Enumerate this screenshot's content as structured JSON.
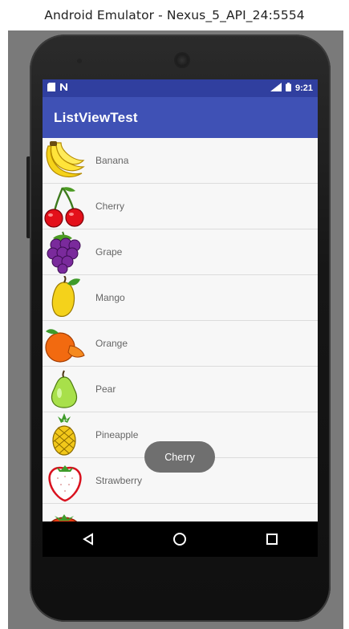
{
  "window": {
    "title": "Android Emulator - Nexus_5_API_24:5554"
  },
  "status_bar": {
    "time": "9:21",
    "left_icons": [
      "sd-card-icon",
      "notification-n-icon"
    ],
    "right_icons": [
      "signal-icon",
      "battery-icon"
    ]
  },
  "app_bar": {
    "title": "ListViewTest"
  },
  "list": {
    "items": [
      {
        "label": "Banana",
        "icon": "banana-icon"
      },
      {
        "label": "Cherry",
        "icon": "cherry-icon"
      },
      {
        "label": "Grape",
        "icon": "grape-icon"
      },
      {
        "label": "Mango",
        "icon": "mango-icon"
      },
      {
        "label": "Orange",
        "icon": "orange-icon"
      },
      {
        "label": "Pear",
        "icon": "pear-icon"
      },
      {
        "label": "Pineapple",
        "icon": "pineapple-icon"
      },
      {
        "label": "Strawberry",
        "icon": "strawberry-icon"
      },
      {
        "label": "",
        "icon": "tomato-icon"
      }
    ]
  },
  "toast": {
    "text": "Cherry"
  },
  "nav_bar": {
    "buttons": [
      "back-icon",
      "home-icon",
      "recents-icon"
    ]
  },
  "colors": {
    "primary": "#3F51B5",
    "primary_dark": "#303F9F",
    "emulator_bg": "#7a7a7a"
  }
}
